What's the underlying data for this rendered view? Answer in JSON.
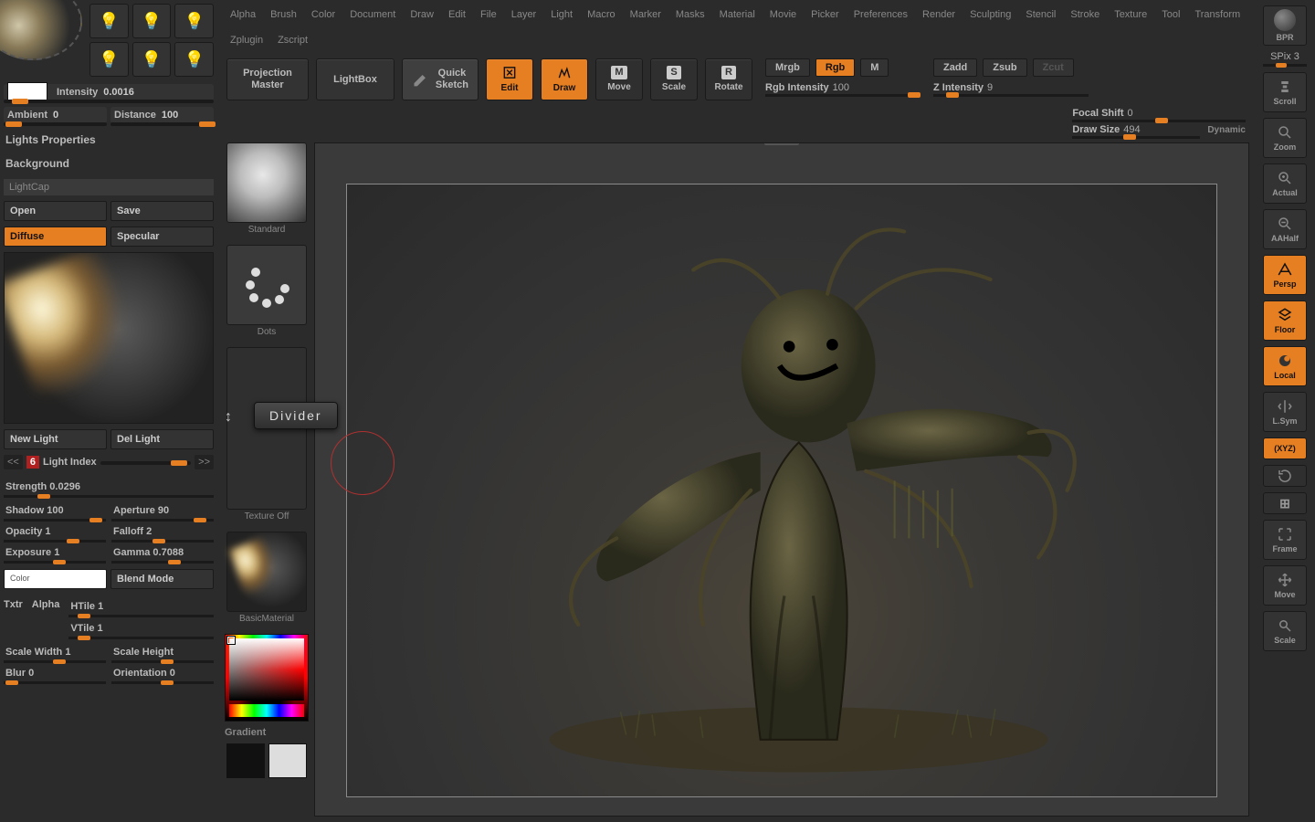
{
  "menu": [
    "Alpha",
    "Brush",
    "Color",
    "Document",
    "Draw",
    "Edit",
    "File",
    "Layer",
    "Light",
    "Macro",
    "Marker",
    "Masks",
    "Material",
    "Movie",
    "Picker",
    "Preferences",
    "Render",
    "Sculpting",
    "Stencil",
    "Stroke",
    "Texture",
    "Tool",
    "Transform",
    "Zplugin",
    "Zscript"
  ],
  "left": {
    "intensity": {
      "label": "Intensity",
      "value": "0.0016"
    },
    "ambient": {
      "label": "Ambient",
      "value": "0"
    },
    "distance": {
      "label": "Distance",
      "value": "100"
    },
    "lights_properties": "Lights Properties",
    "background": "Background",
    "lightcap": "LightCap",
    "open": "Open",
    "save": "Save",
    "diffuse": "Diffuse",
    "specular": "Specular",
    "new_light": "New Light",
    "del_light": "Del Light",
    "light_index_label": "Light Index",
    "light_index_val": "6",
    "strength": {
      "label": "Strength",
      "value": "0.0296"
    },
    "shadow": {
      "label": "Shadow",
      "value": "100"
    },
    "aperture": {
      "label": "Aperture",
      "value": "90"
    },
    "opacity": {
      "label": "Opacity",
      "value": "1"
    },
    "falloff": {
      "label": "Falloff",
      "value": "2"
    },
    "exposure": {
      "label": "Exposure",
      "value": "1"
    },
    "gamma": {
      "label": "Gamma",
      "value": "0.7088"
    },
    "color": "Color",
    "blend_mode": "Blend Mode",
    "txtr": "Txtr",
    "alpha": "Alpha",
    "htile": {
      "label": "HTile",
      "value": "1"
    },
    "vtile": {
      "label": "VTile",
      "value": "1"
    },
    "scale_width": {
      "label": "Scale Width",
      "value": "1"
    },
    "scale_height": "Scale Height",
    "blur": {
      "label": "Blur",
      "value": "0"
    },
    "orientation": {
      "label": "Orientation",
      "value": "0"
    }
  },
  "toolbar": {
    "projection_master": "Projection\nMaster",
    "lightbox": "LightBox",
    "quick_sketch": "Quick\nSketch",
    "edit": "Edit",
    "draw": "Draw",
    "move": "Move",
    "scale": "Scale",
    "rotate": "Rotate",
    "mrgb": "Mrgb",
    "rgb": "Rgb",
    "m": "M",
    "zadd": "Zadd",
    "zsub": "Zsub",
    "zcut": "Zcut",
    "rgb_intensity": {
      "label": "Rgb Intensity",
      "value": "100"
    },
    "z_intensity": {
      "label": "Z Intensity",
      "value": "9"
    },
    "focal_shift": {
      "label": "Focal Shift",
      "value": "0"
    },
    "draw_size": {
      "label": "Draw Size",
      "value": "494"
    },
    "dynamic": "Dynamic"
  },
  "brush_col": {
    "standard": "Standard",
    "dots": "Dots",
    "divider_tooltip": "Divider",
    "texture_off": "Texture Off",
    "basic_material": "BasicMaterial",
    "gradient": "Gradient"
  },
  "right_bar": {
    "bpr": "BPR",
    "spix": {
      "label": "SPix",
      "value": "3"
    },
    "scroll": "Scroll",
    "zoom": "Zoom",
    "actual": "Actual",
    "aahalf": "AAHalf",
    "persp": "Persp",
    "floor": "Floor",
    "local": "Local",
    "lsym": "L.Sym",
    "xyz": "XYZ",
    "frame": "Frame",
    "move": "Move",
    "scale": "Scale"
  }
}
